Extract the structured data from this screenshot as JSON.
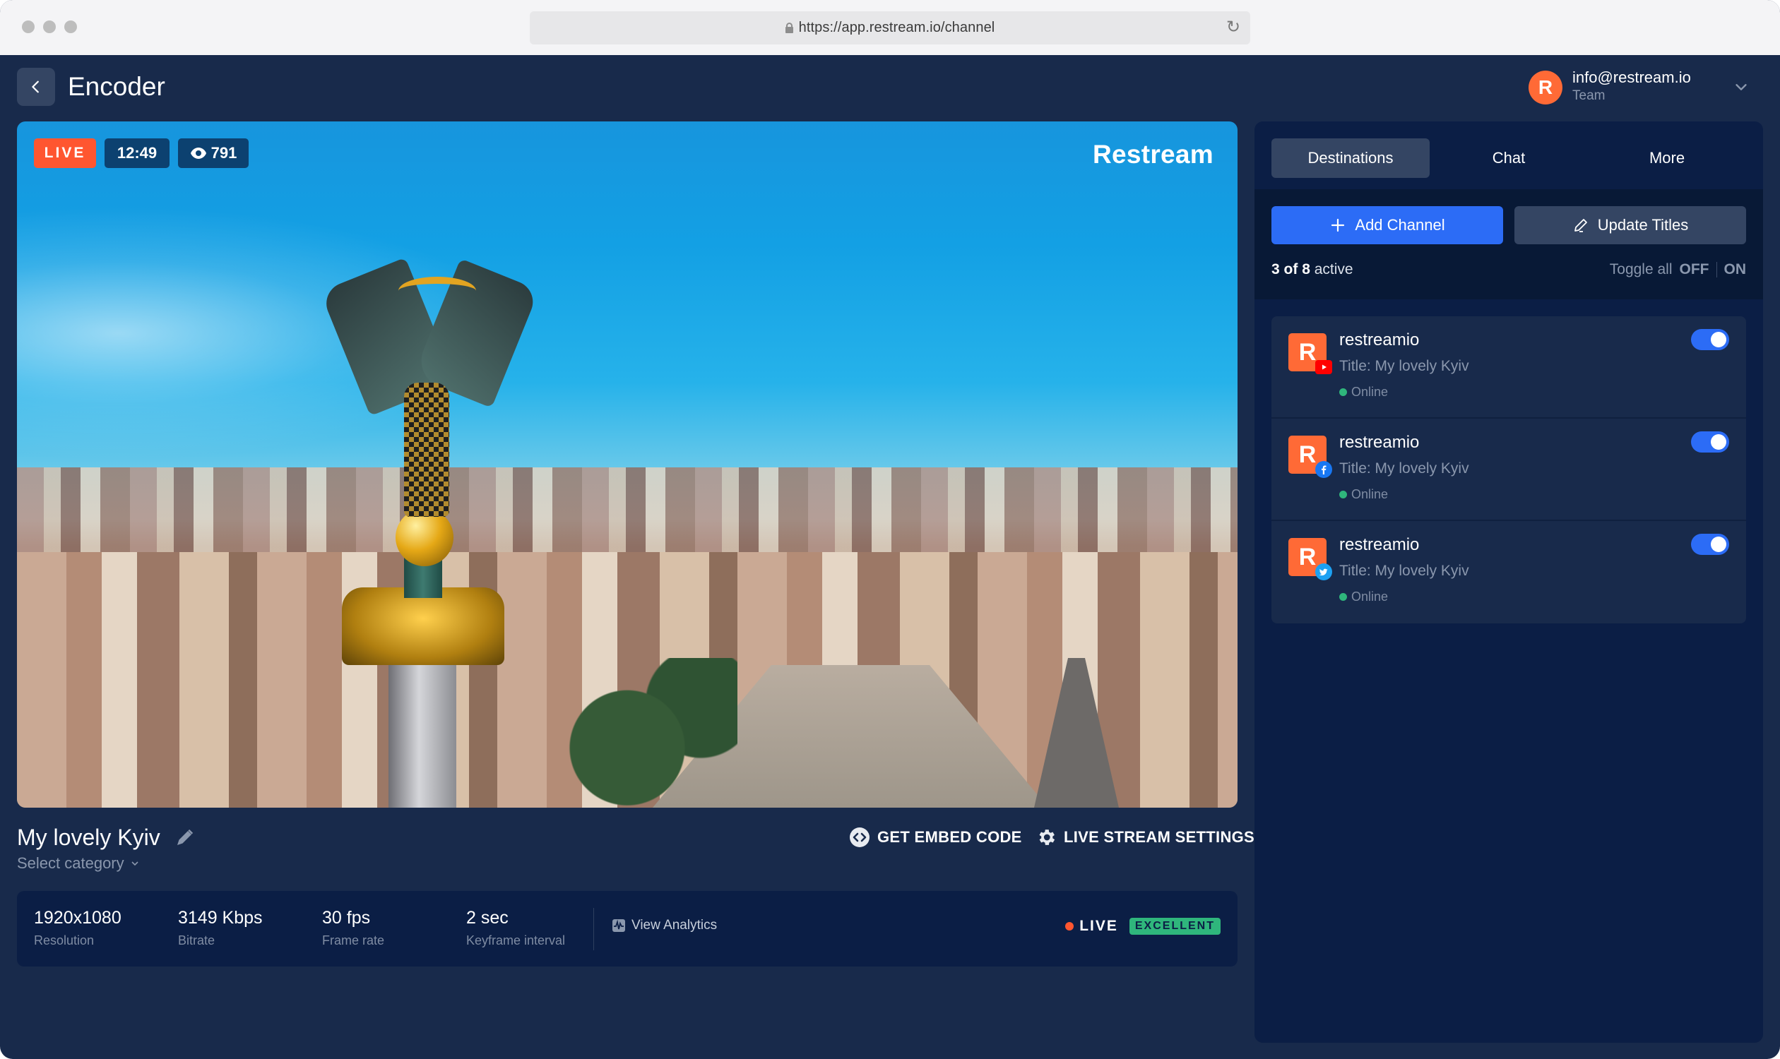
{
  "browser": {
    "url": "https://app.restream.io/channel",
    "reload_icon": "reload-icon",
    "lock_icon": "lock-icon"
  },
  "header": {
    "back_icon": "chevron-left-icon",
    "title": "Encoder",
    "account": {
      "avatar_letter": "R",
      "email": "info@restream.io",
      "role": "Team",
      "dropdown_icon": "chevron-down-icon"
    }
  },
  "video": {
    "live_badge": "LIVE",
    "duration": "12:49",
    "viewers": "791",
    "viewers_icon": "eye-icon",
    "watermark": "Restream"
  },
  "stream": {
    "title": "My lovely Kyiv",
    "edit_icon": "pencil-icon",
    "category_placeholder": "Select category",
    "actions": {
      "embed": "GET EMBED CODE",
      "settings": "LIVE STREAM SETTINGS"
    }
  },
  "stats": {
    "items": [
      {
        "value": "1920x1080",
        "label": "Resolution"
      },
      {
        "value": "3149 Kbps",
        "label": "Bitrate"
      },
      {
        "value": "30 fps",
        "label": "Frame rate"
      },
      {
        "value": "2 sec",
        "label": "Keyframe interval"
      }
    ],
    "analytics_link": "View Analytics",
    "status": "LIVE",
    "quality": "EXCELLENT",
    "colors": {
      "live": "#ff5630",
      "quality": "#2fb67c"
    }
  },
  "sidebar": {
    "tabs": [
      {
        "label": "Destinations",
        "active": true
      },
      {
        "label": "Chat",
        "active": false
      },
      {
        "label": "More",
        "active": false
      }
    ],
    "add_channel": "Add Channel",
    "update_titles": "Update Titles",
    "active_count": {
      "active": "3",
      "of": "of",
      "total": "8",
      "suffix": "active"
    },
    "toggle_all": {
      "label": "Toggle all",
      "off": "OFF",
      "on": "ON"
    },
    "destinations": [
      {
        "name": "restreamio",
        "title": "Title: My lovely Kyiv",
        "status": "Online",
        "platform": "youtube",
        "enabled": true
      },
      {
        "name": "restreamio",
        "title": "Title: My lovely Kyiv",
        "status": "Online",
        "platform": "facebook",
        "enabled": true
      },
      {
        "name": "restreamio",
        "title": "Title: My lovely Kyiv",
        "status": "Online",
        "platform": "twitter",
        "enabled": true
      }
    ],
    "avatar_letter": "R"
  },
  "colors": {
    "app_bg": "#182a4b",
    "panel_bg": "#0b1e45",
    "accent_blue": "#2c6cf6",
    "brand_orange": "#ff6a36"
  }
}
